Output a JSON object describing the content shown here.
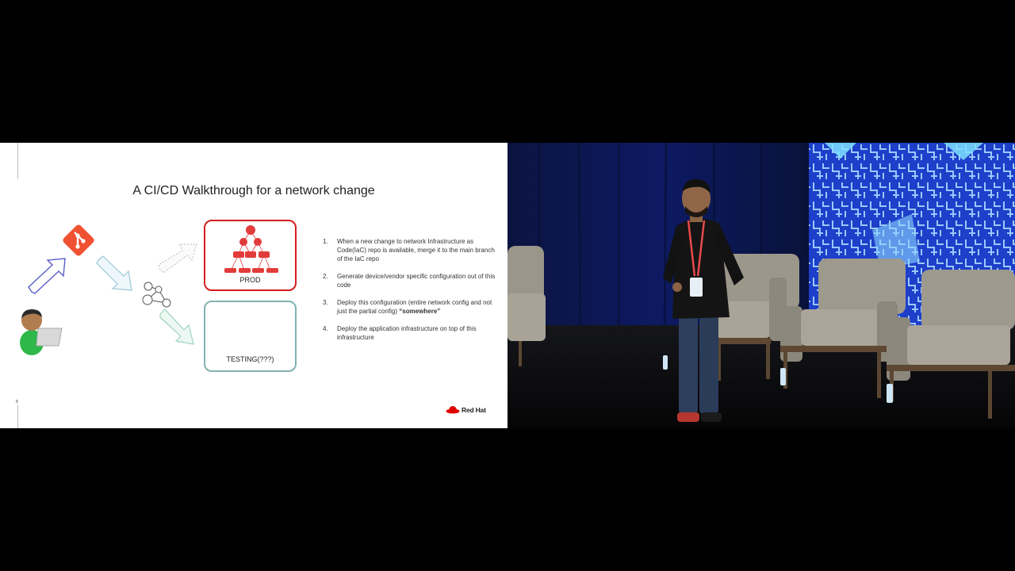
{
  "slide": {
    "title": "A CI/CD Walkthrough for a network change",
    "page_number": "8",
    "prod_label": "PROD",
    "testing_label": "TESTING(???)",
    "steps": [
      {
        "num": "1.",
        "text": "When a new change to network Infrastructure as Code(IaC) repo is available, merge it to the main branch of the IaC repo",
        "bold": ""
      },
      {
        "num": "2.",
        "text": "Generate device/vendor specific configuration out of this code",
        "bold": ""
      },
      {
        "num": "3.",
        "text": "Deploy this configuration (entire network config and not just the partial config) ",
        "bold": "“somewhere”"
      },
      {
        "num": "4.",
        "text": "Deploy the application infrastructure on top of this infrastructure",
        "bold": ""
      }
    ],
    "brand": "Red Hat"
  },
  "colors": {
    "brand_red": "#e00000",
    "git_orange": "#f05133",
    "prod_border": "#d51d1d",
    "testing_border": "#7fb3b0",
    "arrow_blue": "#5b5fc7"
  },
  "icons": [
    "git-icon",
    "developer-icon",
    "pipeline-graph-icon",
    "redhat-hat-icon"
  ]
}
